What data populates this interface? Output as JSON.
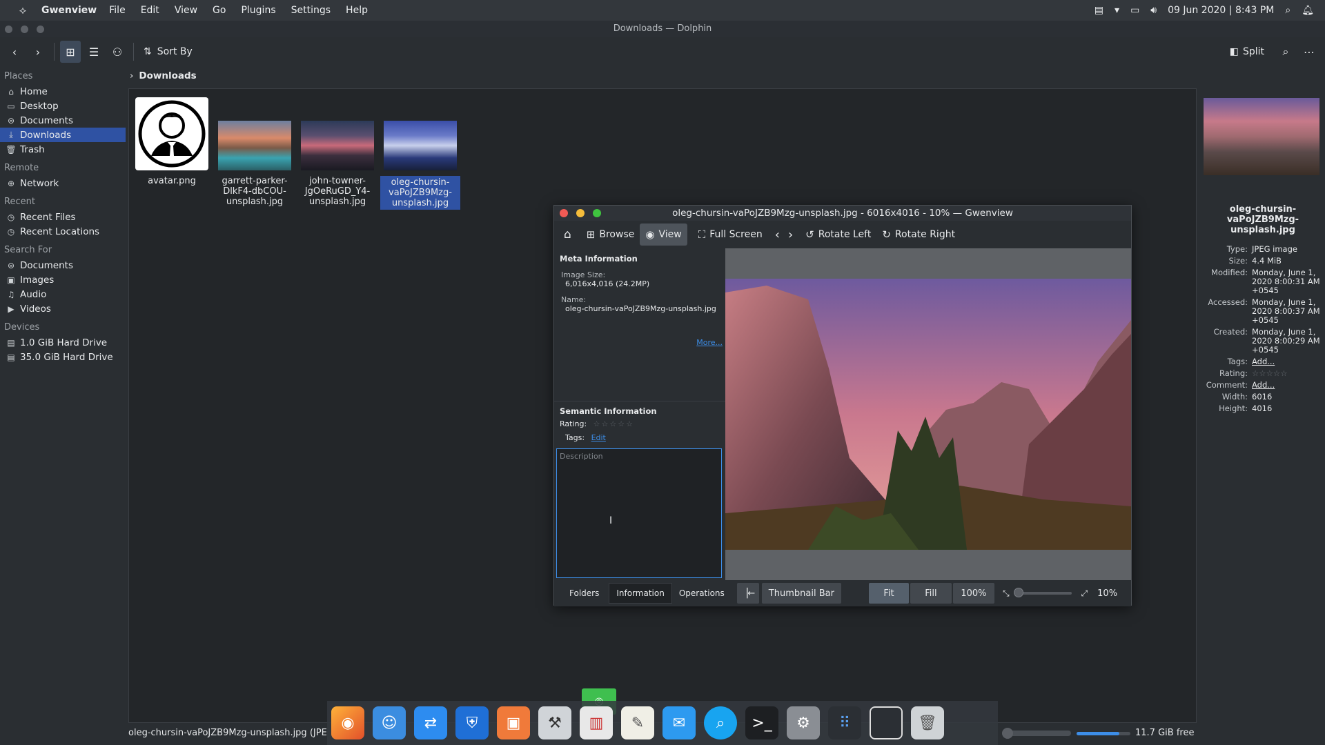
{
  "menubar": {
    "app_name": "Gwenview",
    "menus": [
      "File",
      "Edit",
      "View",
      "Go",
      "Plugins",
      "Settings",
      "Help"
    ],
    "datetime": "09 Jun 2020 | 8:43 PM"
  },
  "dolphin": {
    "window_title": "Downloads — Dolphin",
    "toolbar": {
      "sort_by": "Sort By",
      "split": "Split"
    },
    "breadcrumb": "Downloads",
    "sidebar": {
      "places_header": "Places",
      "places": [
        "Home",
        "Desktop",
        "Documents",
        "Downloads",
        "Trash"
      ],
      "remote_header": "Remote",
      "remote": [
        "Network"
      ],
      "recent_header": "Recent",
      "recent": [
        "Recent Files",
        "Recent Locations"
      ],
      "search_header": "Search For",
      "search": [
        "Documents",
        "Images",
        "Audio",
        "Videos"
      ],
      "devices_header": "Devices",
      "devices": [
        "1.0 GiB Hard Drive",
        "35.0 GiB Hard Drive"
      ]
    },
    "files": [
      {
        "name": "avatar.png"
      },
      {
        "name": "garrett-parker-DlkF4-dbCOU-unsplash.jpg"
      },
      {
        "name": "john-towner-JgOeRuGD_Y4-unsplash.jpg"
      },
      {
        "name": "oleg-chursin-vaPoJZB9Mzg-unsplash.jpg"
      }
    ],
    "info_panel": {
      "title": "oleg-chursin-vaPoJZB9Mzg-unsplash.jpg",
      "type_k": "Type:",
      "type_v": "JPEG image",
      "size_k": "Size:",
      "size_v": "4.4 MiB",
      "modified_k": "Modified:",
      "modified_v": "Monday, June 1, 2020 8:00:31 AM +0545",
      "accessed_k": "Accessed:",
      "accessed_v": "Monday, June 1, 2020 8:00:37 AM +0545",
      "created_k": "Created:",
      "created_v": "Monday, June 1, 2020 8:00:29 AM +0545",
      "tags_k": "Tags:",
      "tags_v": "Add...",
      "rating_k": "Rating:",
      "comment_k": "Comment:",
      "comment_v": "Add...",
      "width_k": "Width:",
      "width_v": "6016",
      "height_k": "Height:",
      "height_v": "4016"
    },
    "status_text": "oleg-chursin-vaPoJZB9Mzg-unsplash.jpg (JPE",
    "free_space": "11.7 GiB free"
  },
  "gwenview": {
    "title": "oleg-chursin-vaPoJZB9Mzg-unsplash.jpg - 6016x4016 - 10% — Gwenview",
    "toolbar": {
      "browse": "Browse",
      "view": "View",
      "fullscreen": "Full Screen",
      "rotate_left": "Rotate Left",
      "rotate_right": "Rotate Right"
    },
    "meta": {
      "header": "Meta Information",
      "image_size_label": "Image Size:",
      "image_size_value": "6,016x4,016 (24.2MP)",
      "name_label": "Name:",
      "name_value": "oleg-chursin-vaPoJZB9Mzg-unsplash.jpg",
      "more": "More..."
    },
    "semantic": {
      "header": "Semantic Information",
      "rating_label": "Rating:",
      "tags_label": "Tags:",
      "tags_edit": "Edit",
      "description_placeholder": "Description"
    },
    "bottom": {
      "tabs": [
        "Folders",
        "Information",
        "Operations"
      ],
      "thumbnail_bar": "Thumbnail Bar",
      "fit": "Fit",
      "fill": "Fill",
      "hundred": "100%",
      "zoom": "10%"
    }
  }
}
